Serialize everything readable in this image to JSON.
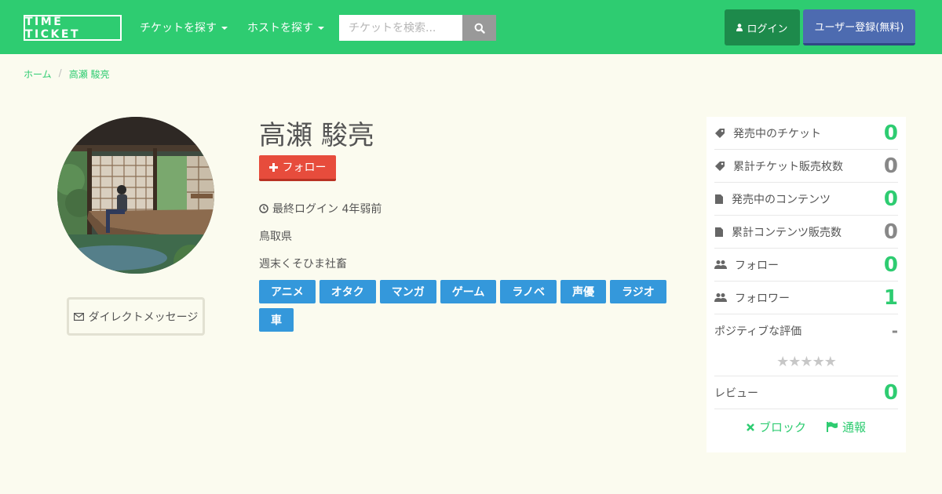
{
  "header": {
    "logo": "TIME TICKET",
    "nav": [
      {
        "label": "チケットを探す"
      },
      {
        "label": "ホストを探す"
      }
    ],
    "search_placeholder": "チケットを検索...",
    "login_label": "ログイン",
    "register_label": "ユーザー登録(無料)",
    "colors": {
      "bar": "#2ecc71",
      "login": "#1d8a4b",
      "register": "#4d6bb0"
    }
  },
  "breadcrumb": {
    "home": "ホーム",
    "separator": "/",
    "current": "高瀬 駿亮"
  },
  "profile": {
    "name": "高瀬 駿亮",
    "follow_label": "フォロー",
    "last_login": "最終ログイン 4年弱前",
    "location": "鳥取県",
    "bio": "週末くそひま社畜",
    "tags": [
      "アニメ",
      "オタク",
      "マンガ",
      "ゲーム",
      "ラノベ",
      "声優",
      "ラジオ",
      "車"
    ],
    "dm_label": "ダイレクトメッセージ"
  },
  "stats": {
    "rows": [
      {
        "label": "発売中のチケット",
        "value": "0",
        "icon": "ticket-icon"
      },
      {
        "label": "累計チケット販売枚数",
        "value": "0",
        "icon": "ticket-icon"
      },
      {
        "label": "発売中のコンテンツ",
        "value": "0",
        "icon": "file-icon"
      },
      {
        "label": "累計コンテンツ販売数",
        "value": "0",
        "icon": "file-icon"
      },
      {
        "label": "フォロー",
        "value": "0",
        "icon": "users-icon"
      },
      {
        "label": "フォロワー",
        "value": "1",
        "icon": "users-icon"
      }
    ],
    "positive_label": "ポジティブな評価",
    "positive_value": "-",
    "stars": "★★★★★",
    "rating_stars": 0,
    "review_label": "レビュー",
    "review_value": "0",
    "block_label": "ブロック",
    "report_label": "通報"
  }
}
